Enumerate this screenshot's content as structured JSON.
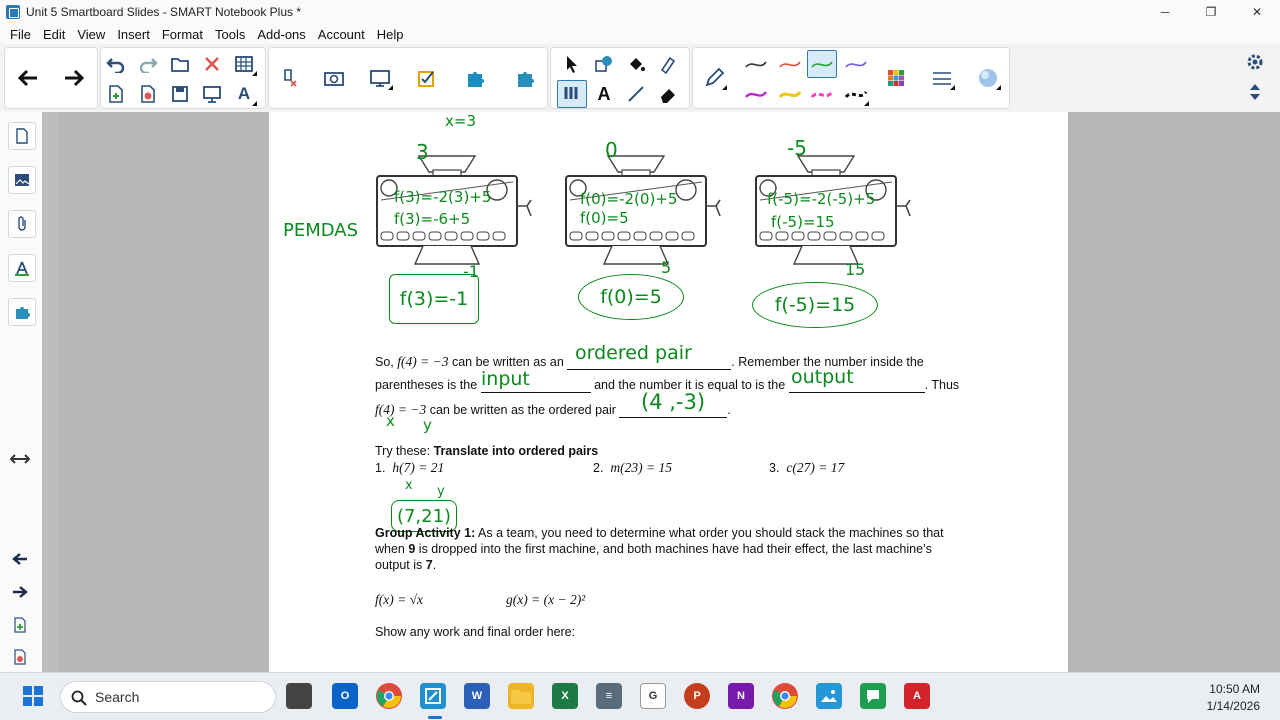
{
  "window": {
    "title": "Unit 5 Smartboard Slides - SMART Notebook Plus *",
    "minimize": "─",
    "maximize": "❐",
    "close": "✕"
  },
  "menu": [
    "File",
    "Edit",
    "View",
    "Insert",
    "Format",
    "Tools",
    "Add-ons",
    "Account",
    "Help"
  ],
  "toolbar": {
    "selected_pen_color": "#2ca02c",
    "pen_colors": [
      "#333333",
      "#e74c3c",
      "#2ca02c",
      "#6c5ce7",
      "#c026d3",
      "#f1c40f",
      "#ff3fbf",
      "#111111"
    ]
  },
  "document": {
    "machines": [
      {
        "input": "3",
        "line1": "f(3)=-2(3)+5",
        "line2": "f(3)=-6+5",
        "below": "-1",
        "answer": "f(3)=-1"
      },
      {
        "input": "0",
        "line1": "f(0)=-2(0)+5",
        "line2": "f(0)=5",
        "below": "5",
        "answer": "f(0)=5"
      },
      {
        "input": "-5",
        "line1": "f(-5)=-2(-5)+5",
        "line2": "f(-5)=15",
        "below": "15",
        "answer": "f(-5)=15"
      }
    ],
    "top_partial": "x=3",
    "pemdas": "PEMDAS",
    "para1_a": "So, ",
    "para1_math": "f(4) = −3",
    "para1_b": " can be written as an ",
    "para1_c": ". Remember the number inside the",
    "para2_a": "parentheses is the ",
    "para2_b": " and the number it is equal to is the ",
    "para2_c": ". Thus",
    "para3_math": "f(4) = −3",
    "para3_b": " can be written as the ordered pair ",
    "para3_c": ".",
    "ink_ordered_pair": "ordered pair",
    "ink_input": "input",
    "ink_output": "output",
    "ink_pair": "(4 ,-3)",
    "ink_x": "x",
    "ink_y": "y",
    "try_label": "Try these:  ",
    "try_bold": "Translate into ordered pairs",
    "q1_num": "1.",
    "q1": "h(7) = 21",
    "q2_num": "2.",
    "q2": "m(23) = 15",
    "q3_num": "3.",
    "q3": "c(27) = 17",
    "q1_ink_x": "x",
    "q1_ink_y": "y",
    "q1_ink_pair": "(7,21)",
    "group_bold": "Group Activity 1:",
    "group_text1": "  As a team, you need to determine what order you should stack the machines so that",
    "group_text2a": "when ",
    "group_nine": "9",
    "group_text2b": " is dropped into the first machine, and both machines have had their effect, the last machine’s",
    "group_text3a": "output is ",
    "group_seven": "7",
    "group_text3b": ".",
    "fx": "f(x) = √x",
    "gx": "g(x) = (x − 2)²",
    "show_work": "Show any work and final order here:"
  },
  "taskbar": {
    "search_placeholder": "Search",
    "time": "10:50 AM",
    "date": "1/14/2026"
  }
}
